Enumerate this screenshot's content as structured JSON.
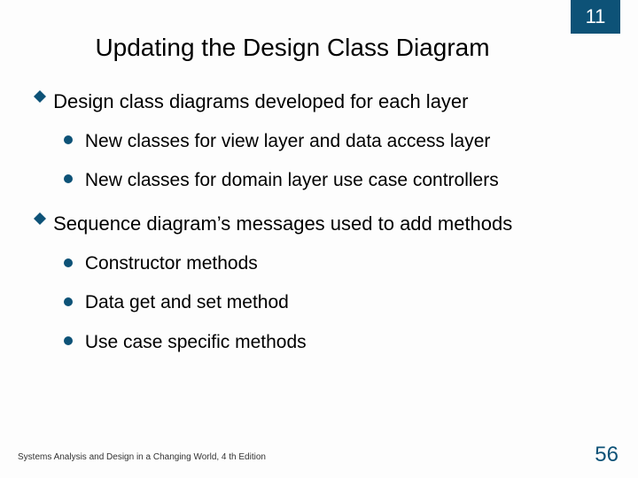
{
  "chapter": "11",
  "title": "Updating the Design Class Diagram",
  "bullets": {
    "b1": {
      "text": "Design class diagrams developed for each layer",
      "sub": {
        "s1": "New classes for view layer and data access layer",
        "s2": "New classes for domain layer use case controllers"
      }
    },
    "b2": {
      "text": "Sequence diagram’s messages used to add methods",
      "sub": {
        "s1": "Constructor methods",
        "s2": "Data get and set method",
        "s3": "Use case specific methods"
      }
    }
  },
  "footer": {
    "left": "Systems Analysis and Design in a Changing World, 4 th Edition",
    "page": "56"
  }
}
